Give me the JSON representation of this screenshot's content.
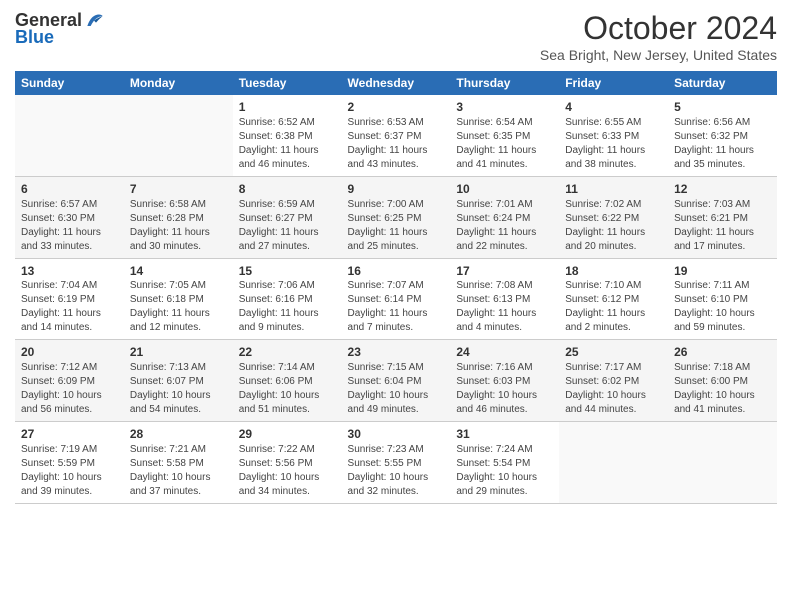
{
  "logo": {
    "general": "General",
    "blue": "Blue"
  },
  "title": "October 2024",
  "location": "Sea Bright, New Jersey, United States",
  "days_of_week": [
    "Sunday",
    "Monday",
    "Tuesday",
    "Wednesday",
    "Thursday",
    "Friday",
    "Saturday"
  ],
  "weeks": [
    [
      {
        "day": "",
        "sunrise": "",
        "sunset": "",
        "daylight": ""
      },
      {
        "day": "",
        "sunrise": "",
        "sunset": "",
        "daylight": ""
      },
      {
        "day": "1",
        "sunrise": "Sunrise: 6:52 AM",
        "sunset": "Sunset: 6:38 PM",
        "daylight": "Daylight: 11 hours and 46 minutes."
      },
      {
        "day": "2",
        "sunrise": "Sunrise: 6:53 AM",
        "sunset": "Sunset: 6:37 PM",
        "daylight": "Daylight: 11 hours and 43 minutes."
      },
      {
        "day": "3",
        "sunrise": "Sunrise: 6:54 AM",
        "sunset": "Sunset: 6:35 PM",
        "daylight": "Daylight: 11 hours and 41 minutes."
      },
      {
        "day": "4",
        "sunrise": "Sunrise: 6:55 AM",
        "sunset": "Sunset: 6:33 PM",
        "daylight": "Daylight: 11 hours and 38 minutes."
      },
      {
        "day": "5",
        "sunrise": "Sunrise: 6:56 AM",
        "sunset": "Sunset: 6:32 PM",
        "daylight": "Daylight: 11 hours and 35 minutes."
      }
    ],
    [
      {
        "day": "6",
        "sunrise": "Sunrise: 6:57 AM",
        "sunset": "Sunset: 6:30 PM",
        "daylight": "Daylight: 11 hours and 33 minutes."
      },
      {
        "day": "7",
        "sunrise": "Sunrise: 6:58 AM",
        "sunset": "Sunset: 6:28 PM",
        "daylight": "Daylight: 11 hours and 30 minutes."
      },
      {
        "day": "8",
        "sunrise": "Sunrise: 6:59 AM",
        "sunset": "Sunset: 6:27 PM",
        "daylight": "Daylight: 11 hours and 27 minutes."
      },
      {
        "day": "9",
        "sunrise": "Sunrise: 7:00 AM",
        "sunset": "Sunset: 6:25 PM",
        "daylight": "Daylight: 11 hours and 25 minutes."
      },
      {
        "day": "10",
        "sunrise": "Sunrise: 7:01 AM",
        "sunset": "Sunset: 6:24 PM",
        "daylight": "Daylight: 11 hours and 22 minutes."
      },
      {
        "day": "11",
        "sunrise": "Sunrise: 7:02 AM",
        "sunset": "Sunset: 6:22 PM",
        "daylight": "Daylight: 11 hours and 20 minutes."
      },
      {
        "day": "12",
        "sunrise": "Sunrise: 7:03 AM",
        "sunset": "Sunset: 6:21 PM",
        "daylight": "Daylight: 11 hours and 17 minutes."
      }
    ],
    [
      {
        "day": "13",
        "sunrise": "Sunrise: 7:04 AM",
        "sunset": "Sunset: 6:19 PM",
        "daylight": "Daylight: 11 hours and 14 minutes."
      },
      {
        "day": "14",
        "sunrise": "Sunrise: 7:05 AM",
        "sunset": "Sunset: 6:18 PM",
        "daylight": "Daylight: 11 hours and 12 minutes."
      },
      {
        "day": "15",
        "sunrise": "Sunrise: 7:06 AM",
        "sunset": "Sunset: 6:16 PM",
        "daylight": "Daylight: 11 hours and 9 minutes."
      },
      {
        "day": "16",
        "sunrise": "Sunrise: 7:07 AM",
        "sunset": "Sunset: 6:14 PM",
        "daylight": "Daylight: 11 hours and 7 minutes."
      },
      {
        "day": "17",
        "sunrise": "Sunrise: 7:08 AM",
        "sunset": "Sunset: 6:13 PM",
        "daylight": "Daylight: 11 hours and 4 minutes."
      },
      {
        "day": "18",
        "sunrise": "Sunrise: 7:10 AM",
        "sunset": "Sunset: 6:12 PM",
        "daylight": "Daylight: 11 hours and 2 minutes."
      },
      {
        "day": "19",
        "sunrise": "Sunrise: 7:11 AM",
        "sunset": "Sunset: 6:10 PM",
        "daylight": "Daylight: 10 hours and 59 minutes."
      }
    ],
    [
      {
        "day": "20",
        "sunrise": "Sunrise: 7:12 AM",
        "sunset": "Sunset: 6:09 PM",
        "daylight": "Daylight: 10 hours and 56 minutes."
      },
      {
        "day": "21",
        "sunrise": "Sunrise: 7:13 AM",
        "sunset": "Sunset: 6:07 PM",
        "daylight": "Daylight: 10 hours and 54 minutes."
      },
      {
        "day": "22",
        "sunrise": "Sunrise: 7:14 AM",
        "sunset": "Sunset: 6:06 PM",
        "daylight": "Daylight: 10 hours and 51 minutes."
      },
      {
        "day": "23",
        "sunrise": "Sunrise: 7:15 AM",
        "sunset": "Sunset: 6:04 PM",
        "daylight": "Daylight: 10 hours and 49 minutes."
      },
      {
        "day": "24",
        "sunrise": "Sunrise: 7:16 AM",
        "sunset": "Sunset: 6:03 PM",
        "daylight": "Daylight: 10 hours and 46 minutes."
      },
      {
        "day": "25",
        "sunrise": "Sunrise: 7:17 AM",
        "sunset": "Sunset: 6:02 PM",
        "daylight": "Daylight: 10 hours and 44 minutes."
      },
      {
        "day": "26",
        "sunrise": "Sunrise: 7:18 AM",
        "sunset": "Sunset: 6:00 PM",
        "daylight": "Daylight: 10 hours and 41 minutes."
      }
    ],
    [
      {
        "day": "27",
        "sunrise": "Sunrise: 7:19 AM",
        "sunset": "Sunset: 5:59 PM",
        "daylight": "Daylight: 10 hours and 39 minutes."
      },
      {
        "day": "28",
        "sunrise": "Sunrise: 7:21 AM",
        "sunset": "Sunset: 5:58 PM",
        "daylight": "Daylight: 10 hours and 37 minutes."
      },
      {
        "day": "29",
        "sunrise": "Sunrise: 7:22 AM",
        "sunset": "Sunset: 5:56 PM",
        "daylight": "Daylight: 10 hours and 34 minutes."
      },
      {
        "day": "30",
        "sunrise": "Sunrise: 7:23 AM",
        "sunset": "Sunset: 5:55 PM",
        "daylight": "Daylight: 10 hours and 32 minutes."
      },
      {
        "day": "31",
        "sunrise": "Sunrise: 7:24 AM",
        "sunset": "Sunset: 5:54 PM",
        "daylight": "Daylight: 10 hours and 29 minutes."
      },
      {
        "day": "",
        "sunrise": "",
        "sunset": "",
        "daylight": ""
      },
      {
        "day": "",
        "sunrise": "",
        "sunset": "",
        "daylight": ""
      }
    ]
  ]
}
